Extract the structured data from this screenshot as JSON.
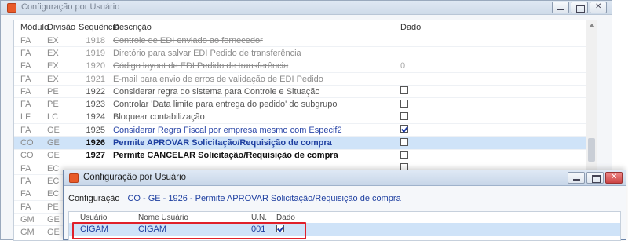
{
  "back_window": {
    "title": "Configuração por Usuário",
    "columns": {
      "modulo": "Módulo",
      "divisao": "Divisão",
      "sequencia": "Sequência",
      "descricao": "Descrição",
      "dado": "Dado"
    },
    "rows": [
      {
        "modulo": "FA",
        "divisao": "EX",
        "seq": "1918",
        "desc": "Controle de EDI enviado ao fornecedor",
        "dado": "",
        "style": "disabled"
      },
      {
        "modulo": "FA",
        "divisao": "EX",
        "seq": "1919",
        "desc": "Diretório para salvar EDI Pedido de transferência",
        "dado": "",
        "style": "disabled"
      },
      {
        "modulo": "FA",
        "divisao": "EX",
        "seq": "1920",
        "desc": "Código layout de EDI Pedido de transferência",
        "dado": "0",
        "style": "disabled"
      },
      {
        "modulo": "FA",
        "divisao": "EX",
        "seq": "1921",
        "desc": "E-mail para envio de erros de validação de EDI Pedido",
        "dado": "",
        "style": "disabled"
      },
      {
        "modulo": "FA",
        "divisao": "PE",
        "seq": "1922",
        "desc": "Considerar regra do sistema para Controle e Situação",
        "dado": "checkbox",
        "checked": false,
        "style": "normal"
      },
      {
        "modulo": "FA",
        "divisao": "PE",
        "seq": "1923",
        "desc": "Controlar 'Data limite para entrega do pedido' do subgrupo",
        "dado": "checkbox",
        "checked": false,
        "style": "normal"
      },
      {
        "modulo": "LF",
        "divisao": "LC",
        "seq": "1924",
        "desc": "Bloquear contabilização",
        "dado": "checkbox",
        "checked": false,
        "style": "normal"
      },
      {
        "modulo": "FA",
        "divisao": "GE",
        "seq": "1925",
        "desc": "Considerar Regra Fiscal por empresa mesmo com Especif2",
        "dado": "checkbox",
        "checked": true,
        "style": "blue"
      },
      {
        "modulo": "CO",
        "divisao": "GE",
        "seq": "1926",
        "desc": "Permite APROVAR Solicitação/Requisição de compra",
        "dado": "checkbox",
        "checked": false,
        "style": "bold-blue-selected"
      },
      {
        "modulo": "CO",
        "divisao": "GE",
        "seq": "1927",
        "desc": "Permite CANCELAR Solicitação/Requisição de compra",
        "dado": "checkbox",
        "checked": false,
        "style": "bold"
      },
      {
        "modulo": "FA",
        "divisao": "EC",
        "seq": "",
        "desc": "",
        "dado": "checkbox",
        "checked": false,
        "style": "normal"
      },
      {
        "modulo": "FA",
        "divisao": "EC",
        "seq": "",
        "desc": "",
        "dado": "",
        "style": "normal"
      },
      {
        "modulo": "FA",
        "divisao": "EC",
        "seq": "",
        "desc": "",
        "dado": "",
        "style": "normal"
      },
      {
        "modulo": "FA",
        "divisao": "PE",
        "seq": "",
        "desc": "",
        "dado": "",
        "style": "normal"
      },
      {
        "modulo": "GM",
        "divisao": "GE",
        "seq": "",
        "desc": "",
        "dado": "",
        "style": "normal"
      },
      {
        "modulo": "GM",
        "divisao": "GE",
        "seq": "",
        "desc": "",
        "dado": "",
        "style": "normal"
      }
    ]
  },
  "front_window": {
    "title": "Configuração por Usuário",
    "config_label": "Configuração",
    "config_value": "CO - GE - 1926 - Permite APROVAR Solicitação/Requisição de compra",
    "columns": {
      "usuario": "Usuário",
      "nome": "Nome Usuário",
      "un": "U.N.",
      "dado": "Dado"
    },
    "row": {
      "usuario": "CIGAM",
      "nome": "CIGAM",
      "un": "001",
      "checked": true
    }
  },
  "colors": {
    "selection": "#cfe3f8",
    "link_blue": "#1e3fa0",
    "highlight_red": "#e0202a",
    "app_icon": "#e85b2a"
  }
}
